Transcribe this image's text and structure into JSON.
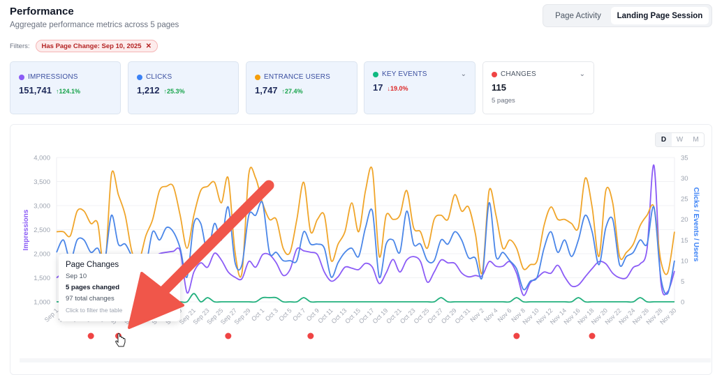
{
  "header": {
    "title": "Performance",
    "subtitle": "Aggregate performance metrics across 5 pages"
  },
  "filters": {
    "label": "Filters:",
    "chips": [
      {
        "label": "Has Page Change: Sep 10, 2025",
        "remove_icon": "close-icon"
      }
    ]
  },
  "view_toggle": {
    "options": [
      "Page Activity",
      "Landing Page Session"
    ],
    "selected": "Landing Page Session"
  },
  "metrics": [
    {
      "label": "IMPRESSIONS",
      "value": "151,741",
      "delta": "↑124.1%",
      "direction": "up",
      "color": "#8b5cf6"
    },
    {
      "label": "CLICKS",
      "value": "1,212",
      "delta": "↑25.3%",
      "direction": "up",
      "color": "#3b82f6"
    },
    {
      "label": "ENTRANCE USERS",
      "value": "1,747",
      "delta": "↑27.4%",
      "direction": "up",
      "color": "#f59e0b"
    },
    {
      "label": "KEY EVENTS",
      "value": "17",
      "delta": "↓19.0%",
      "direction": "down",
      "color": "#10b981",
      "dropdown": true
    },
    {
      "label": "CHANGES",
      "value": "115",
      "sub": "5 pages",
      "color": "#ef4444",
      "dropdown": true
    }
  ],
  "granularity": {
    "options": [
      "D",
      "W",
      "M"
    ],
    "selected": "D"
  },
  "tooltip": {
    "title": "Page Changes",
    "date": "Sep 10",
    "pages": "5 pages changed",
    "total": "97 total changes",
    "hint": "Click to filter the table"
  },
  "chart_data": {
    "type": "line",
    "x_start": "Sep 1",
    "x_end": "Nov 30",
    "frequency": "daily",
    "x_ticks": [
      "Sep 1",
      "Sep 3",
      "Sep 5",
      "Sep 7",
      "Sep 9",
      "Sep 11",
      "Sep 13",
      "Sep 15",
      "Sep 17",
      "Sep 19",
      "Sep 21",
      "Sep 23",
      "Sep 25",
      "Sep 27",
      "Sep 29",
      "Oct 1",
      "Oct 3",
      "Oct 5",
      "Oct 7",
      "Oct 9",
      "Oct 11",
      "Oct 13",
      "Oct 15",
      "Oct 17",
      "Oct 19",
      "Oct 21",
      "Oct 23",
      "Oct 25",
      "Oct 27",
      "Oct 29",
      "Oct 31",
      "Nov 2",
      "Nov 4",
      "Nov 6",
      "Nov 8",
      "Nov 10",
      "Nov 12",
      "Nov 14",
      "Nov 16",
      "Nov 18",
      "Nov 20",
      "Nov 22",
      "Nov 24",
      "Nov 26",
      "Nov 28",
      "Nov 30"
    ],
    "y_left": {
      "label": "Impressions",
      "range": [
        1000,
        4000
      ],
      "ticks": [
        "1,000",
        "1,500",
        "2,000",
        "2,500",
        "3,000",
        "3,500",
        "4,000"
      ],
      "color": "#8b5cf6"
    },
    "y_right": {
      "label": "Clicks / Events / Users",
      "range": [
        0,
        35
      ],
      "ticks": [
        "0",
        "5",
        "10",
        "15",
        "20",
        "25",
        "30",
        "35"
      ],
      "color": "#3b82f6"
    },
    "grid": true,
    "series": [
      {
        "key": "impressions",
        "axis": "left",
        "color": "#8b5cf6",
        "values": [
          1500,
          1600,
          1650,
          1700,
          1600,
          1550,
          1700,
          1500,
          1650,
          1700,
          1750,
          1600,
          1700,
          1800,
          1900,
          2000,
          2030,
          2050,
          2060,
          1190,
          1620,
          1810,
          1720,
          2010,
          1870,
          1620,
          1510,
          1480,
          1840,
          1720,
          1980,
          1980,
          1810,
          1550,
          1670,
          2100,
          2060,
          2030,
          1980,
          1620,
          1430,
          1520,
          1720,
          1700,
          1670,
          1800,
          1720,
          1380,
          1600,
          1880,
          1620,
          1870,
          1940,
          1840,
          1410,
          1620,
          1870,
          1810,
          1800,
          1600,
          1520,
          1546,
          1546,
          1836,
          1740,
          1740,
          1836,
          1594,
          1135,
          1400,
          1500,
          1620,
          1594,
          1760,
          1520,
          1330,
          1350,
          1520,
          1690,
          1836,
          1790,
          1594,
          1500,
          1500,
          1715,
          1790,
          2100,
          3840,
          1425,
          1210,
          1640
        ]
      },
      {
        "key": "entrance_users",
        "axis": "right",
        "color": "#f0a52a",
        "values": [
          17,
          17,
          16,
          22,
          22,
          19,
          19,
          8,
          31,
          26,
          21,
          12,
          10,
          16,
          20,
          27,
          28,
          28,
          21,
          13,
          21,
          27,
          28,
          29,
          24,
          30,
          12,
          7,
          31,
          30,
          24,
          20,
          20,
          13,
          12,
          20,
          29,
          17,
          20,
          21,
          10,
          14,
          17,
          24,
          17,
          27,
          32,
          11,
          21,
          20,
          21,
          27,
          18,
          17,
          13,
          20,
          21,
          20,
          26,
          22,
          23,
          16.5,
          7,
          27,
          21,
          13,
          15,
          13,
          8,
          9,
          10,
          18.5,
          23,
          20,
          20,
          19,
          18,
          30,
          23,
          11,
          27,
          24,
          11,
          12,
          14,
          18.5,
          21,
          23,
          10,
          7,
          17
        ]
      },
      {
        "key": "clicks",
        "axis": "right",
        "color": "#4a86e8",
        "values": [
          12,
          15,
          10,
          15,
          15,
          12,
          13,
          10,
          21,
          14,
          14,
          11,
          9,
          9,
          17,
          15,
          18,
          17,
          13,
          6,
          19,
          19,
          12,
          19,
          15,
          23,
          9.5,
          9,
          21,
          21,
          24,
          12,
          12,
          10,
          10,
          10,
          17,
          14,
          14,
          13,
          6,
          9.5,
          12,
          13,
          11,
          18,
          22,
          6,
          14,
          15,
          12,
          22,
          14,
          14,
          10,
          10,
          15,
          14,
          17,
          15,
          10.7,
          10.6,
          6,
          24,
          11,
          12,
          10,
          8,
          3,
          5,
          6,
          13,
          17,
          12,
          15,
          11,
          15,
          21,
          17,
          9,
          18,
          20,
          9,
          11,
          12,
          15,
          14,
          23,
          6,
          2,
          10
        ]
      },
      {
        "key": "key_events",
        "axis": "right",
        "color": "#22b07d",
        "values": [
          0,
          0,
          0,
          0,
          0,
          0,
          0,
          0,
          0,
          0,
          0,
          0,
          0,
          0,
          0,
          0,
          0,
          0,
          0,
          0,
          2,
          0,
          1,
          0,
          0,
          0,
          0,
          0,
          0,
          0,
          1,
          1,
          1,
          0,
          0,
          0,
          1,
          0,
          0,
          0,
          0,
          0,
          0,
          0,
          0,
          0,
          0,
          0,
          0,
          0,
          0,
          0,
          0,
          0,
          0,
          0,
          1,
          0,
          0,
          0,
          0,
          0,
          0,
          0,
          0,
          0,
          0,
          1,
          0,
          0,
          0,
          0,
          0,
          0,
          0,
          0,
          1,
          0,
          0,
          0,
          0,
          0,
          0,
          0,
          0,
          1,
          0,
          0,
          0,
          0,
          0
        ]
      }
    ],
    "change_markers": {
      "color": "#ef4444",
      "dates": [
        "Sep 6",
        "Sep 10",
        "Sep 26",
        "Oct 8",
        "Nov 7",
        "Nov 18"
      ]
    }
  },
  "annotation": {
    "arrow_color": "#f0564a"
  }
}
